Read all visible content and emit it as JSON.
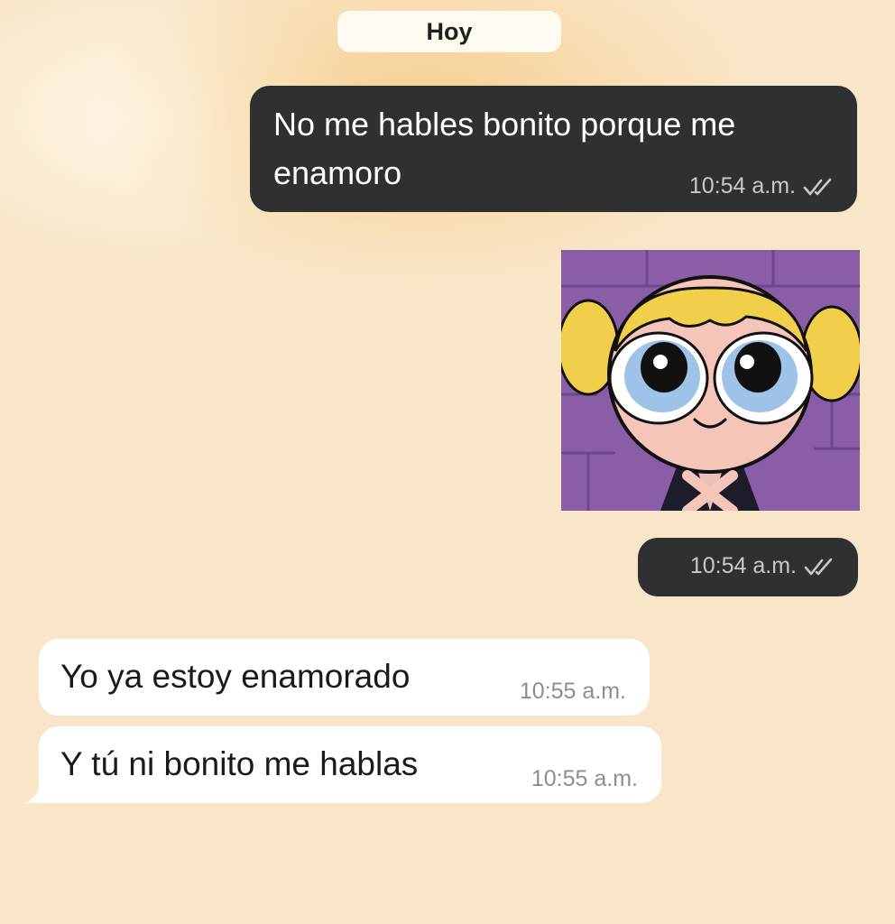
{
  "date_divider": "Hoy",
  "messages": [
    {
      "direction": "outgoing",
      "text": "No me hables bonito porque me enamoro",
      "time": "10:54 a.m.",
      "status_icon": "double-check-icon"
    },
    {
      "direction": "outgoing",
      "type": "sticker",
      "sticker_icon": "bubbles-powerpuff-sticker",
      "time": "10:54 a.m.",
      "status_icon": "double-check-icon"
    },
    {
      "direction": "incoming",
      "text": "Yo ya estoy enamorado",
      "time": "10:55 a.m."
    },
    {
      "direction": "incoming",
      "text": "Y tú ni bonito me hablas",
      "time": "10:55 a.m."
    }
  ],
  "colors": {
    "background": "#f9e6c8",
    "outgoing_bubble": "#2f3032",
    "incoming_bubble": "#ffffff",
    "sticker_background": "#8a5ea6"
  }
}
